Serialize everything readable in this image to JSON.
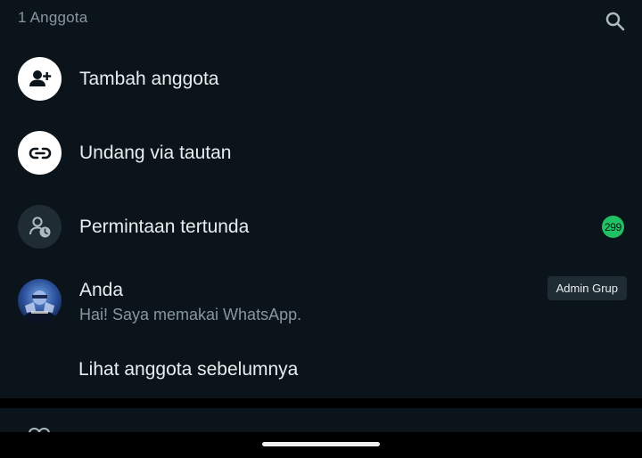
{
  "header": {
    "member_count": "1 Anggota",
    "search_icon": "search-icon"
  },
  "actions": [
    {
      "label": "Tambah anggota",
      "icon": "add-person-icon"
    },
    {
      "label": "Undang via tautan",
      "icon": "link-icon"
    },
    {
      "label": "Permintaan tertunda",
      "icon": "pending-person-icon",
      "count": "299"
    }
  ],
  "members": [
    {
      "name": "Anda",
      "status": "Hai! Saya memakai WhatsApp.",
      "role_badge": "Admin Grup"
    }
  ],
  "see_more_label": "Lihat anggota sebelumnya",
  "colors": {
    "background": "#0b141a",
    "accent_green": "#21c063",
    "primary_text": "#e9edef",
    "secondary_text": "#8696a0"
  }
}
